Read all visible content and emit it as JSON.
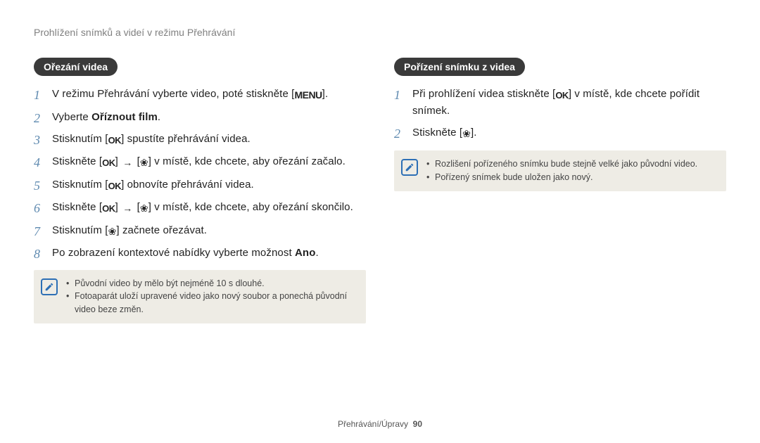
{
  "breadcrumb": "Prohlížení snímků a videí v režimu Přehrávání",
  "icons": {
    "menu": "MENU",
    "ok": "OK",
    "flower": "❀",
    "arrow": "→"
  },
  "left": {
    "title": "Ořezání videa",
    "steps": [
      {
        "pre": "V režimu Přehrávání vyberte video, poté stiskněte [",
        "ico": "menu",
        "post": "]."
      },
      {
        "pre": "Vyberte ",
        "bold": "Oříznout film",
        "post2": "."
      },
      {
        "pre": "Stisknutím [",
        "ico": "ok",
        "post": "] spustíte přehrávání videa."
      },
      {
        "pre": "Stiskněte [",
        "ico": "ok",
        "mid": "] ",
        "arrow": true,
        "mid2": " [",
        "ico2": "flower",
        "post": "] v místě, kde chcete, aby ořezání začalo."
      },
      {
        "pre": "Stisknutím [",
        "ico": "ok",
        "post": "] obnovíte přehrávání videa."
      },
      {
        "pre": "Stiskněte [",
        "ico": "ok",
        "mid": "] ",
        "arrow": true,
        "mid2": " [",
        "ico2": "flower",
        "post": "] v místě, kde chcete, aby ořezání skončilo."
      },
      {
        "pre": "Stisknutím [",
        "ico": "flower",
        "post": "] začnete ořezávat."
      },
      {
        "pre": "Po zobrazení kontextové nabídky vyberte možnost ",
        "bold": "Ano",
        "post2": "."
      }
    ],
    "notes": [
      "Původní video by mělo být nejméně 10 s dlouhé.",
      "Fotoaparát uloží upravené video jako nový soubor a ponechá původní video beze změn."
    ]
  },
  "right": {
    "title": "Pořízení snímku z videa",
    "steps": [
      {
        "pre": "Při prohlížení videa stiskněte [",
        "ico": "ok",
        "post": "] v místě, kde chcete pořídit snímek."
      },
      {
        "pre": "Stiskněte [",
        "ico": "flower",
        "post": "]."
      }
    ],
    "notes": [
      "Rozlišení pořízeného snímku bude stejně velké jako původní video.",
      "Pořízený snímek bude uložen jako nový."
    ]
  },
  "footer": {
    "section": "Přehrávání/Úpravy",
    "page": "90"
  }
}
